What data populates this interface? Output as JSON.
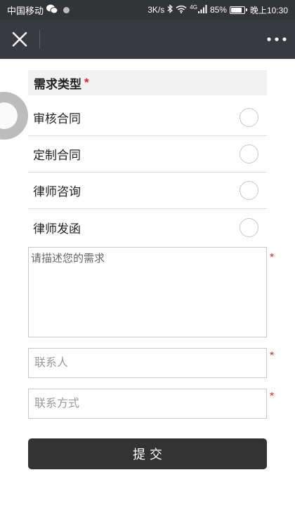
{
  "status_bar": {
    "carrier": "中国移动",
    "net_speed": "3K/s",
    "network": "4G",
    "battery": "85%",
    "time": "晚上10:30",
    "icons": [
      "wechat-icon",
      "notification-dot-icon",
      "bluetooth-icon",
      "wifi-icon",
      "signal-icon",
      "battery-icon"
    ]
  },
  "nav": {
    "left_icon": "close-icon",
    "right_icon": "more-icon"
  },
  "form": {
    "section_title": "需求类型",
    "required_mark": "*",
    "options": [
      {
        "label": "审核合同",
        "selected": false
      },
      {
        "label": "定制合同",
        "selected": false
      },
      {
        "label": "律师咨询",
        "selected": false
      },
      {
        "label": "律师发函",
        "selected": false
      }
    ],
    "description_placeholder": "请描述您的需求",
    "contact_name_placeholder": "联系人",
    "contact_method_placeholder": "联系方式",
    "submit_label": "提交"
  },
  "colors": {
    "status_bar_bg": "#333438",
    "nav_bg": "#393a3f",
    "required": "#e4242b",
    "button_bg": "#333333",
    "section_bg": "#f2f2f2"
  }
}
